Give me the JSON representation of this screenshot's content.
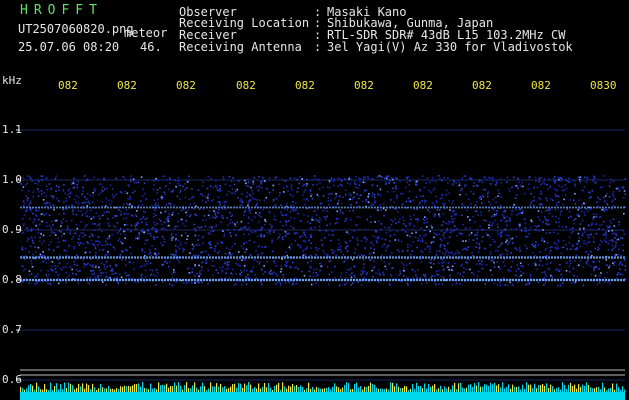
{
  "header": {
    "brand": "HROFFT",
    "filename": "UT2507060820.png",
    "mode": "meteor",
    "datetime": "25.07.06 08:20",
    "count": "46.",
    "fields": [
      {
        "label": "Observer",
        "sep": ":",
        "value": "Masaki Kano"
      },
      {
        "label": "Receiving Location",
        "sep": ":",
        "value": "Shibukawa, Gunma, Japan"
      },
      {
        "label": "Receiver",
        "sep": ":",
        "value": "RTL-SDR SDR# 43dB L15 103.2MHz CW"
      },
      {
        "label": "Receiving Antenna",
        "sep": ":",
        "value": "3el Yagi(V) Az 330 for Vladivostok"
      }
    ]
  },
  "colors": {
    "background": "#000000",
    "brand": "#62e262",
    "text": "#e6e6e6",
    "time_labels": "#f0e642",
    "noise_bar": "#00d8f0",
    "spikes": "#f0e642"
  },
  "chart_data": {
    "type": "heatmap",
    "y_unit": "kHz",
    "y_ticks": [
      "1.1",
      "1.0",
      "0.9",
      "0.8",
      "0.7",
      "0.6"
    ],
    "y_range": [
      0.58,
      1.18
    ],
    "x_ticks": [
      "082",
      "082",
      "082",
      "082",
      "082",
      "082",
      "082",
      "082",
      "082",
      "0830"
    ],
    "signal_band": [
      0.79,
      1.01
    ],
    "lines": [
      {
        "freq": 0.945,
        "strength": 0.5
      },
      {
        "freq": 0.845,
        "strength": 0.8
      },
      {
        "freq": 0.8,
        "strength": 0.9
      }
    ],
    "reference_lines": [
      0.62,
      0.61
    ]
  }
}
